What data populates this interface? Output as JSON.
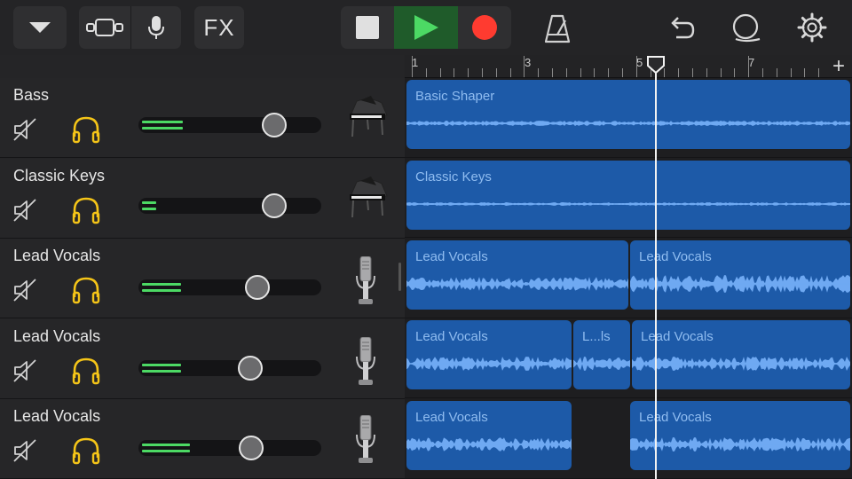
{
  "toolbar": {
    "fx_label": "FX",
    "icons": [
      "dropdown-icon",
      "track-view-icon",
      "mic-icon",
      "stop-icon",
      "play-icon",
      "record-icon",
      "metronome-icon",
      "undo-icon",
      "loop-browser-icon",
      "settings-icon"
    ]
  },
  "colors": {
    "accent_green": "#4cd964",
    "record_red": "#ff3b30",
    "region_blue": "#1d5aa8",
    "solo_yellow": "#f5c518"
  },
  "ruler": {
    "bars": [
      "1",
      "3",
      "5",
      "7"
    ],
    "add_label": "+"
  },
  "tracks": [
    {
      "name": "Bass",
      "instrument": "grand-piano-icon",
      "volume": 0.74,
      "meter": 0.22
    },
    {
      "name": "Classic Keys",
      "instrument": "grand-piano-icon",
      "volume": 0.74,
      "meter": 0.08
    },
    {
      "name": "Lead Vocals",
      "instrument": "microphone-icon",
      "volume": 0.64,
      "meter": 0.22
    },
    {
      "name": "Lead Vocals",
      "instrument": "microphone-icon",
      "volume": 0.6,
      "meter": 0.22
    },
    {
      "name": "Lead Vocals",
      "instrument": "microphone-icon",
      "volume": 0.6,
      "meter": 0.26
    }
  ],
  "regions": [
    {
      "name": "Basic Shaper"
    },
    {
      "name": "Classic Keys"
    },
    {
      "name": "Lead Vocals"
    },
    {
      "name": "Lead Vocals"
    },
    {
      "name": "Lead Vocals"
    },
    {
      "name": "L...ls"
    },
    {
      "name": "Lead Vocals"
    },
    {
      "name": "Lead Vocals"
    },
    {
      "name": "Lead Vocals"
    }
  ]
}
